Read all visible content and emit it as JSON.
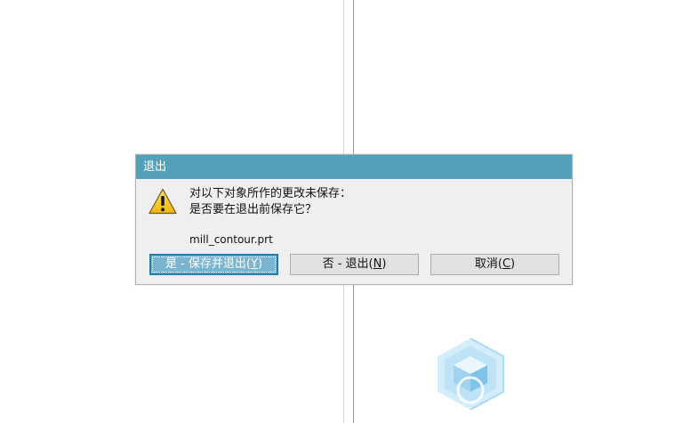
{
  "dialog": {
    "title": "退出",
    "message_line1": "对以下对象所作的更改未保存：",
    "message_line2": "是否要在退出前保存它？",
    "filename": "mill_contour.prt",
    "buttons": {
      "save_exit": {
        "label": "是 - 保存并退出(",
        "key": "Y",
        "end": ")"
      },
      "no_exit": {
        "label": "否 - 退出(",
        "key": "N",
        "end": ")"
      },
      "cancel": {
        "label": "取消(",
        "key": "C",
        "end": ")"
      }
    },
    "icon": "warning-icon"
  },
  "background": {
    "logo_icon": "cube-hexagon-logo-icon"
  },
  "colors": {
    "titlebar": "#52a0b9",
    "dialog_bg": "#efefef",
    "default_button": "#7ab4cf",
    "logo": "#bfe3f6"
  }
}
